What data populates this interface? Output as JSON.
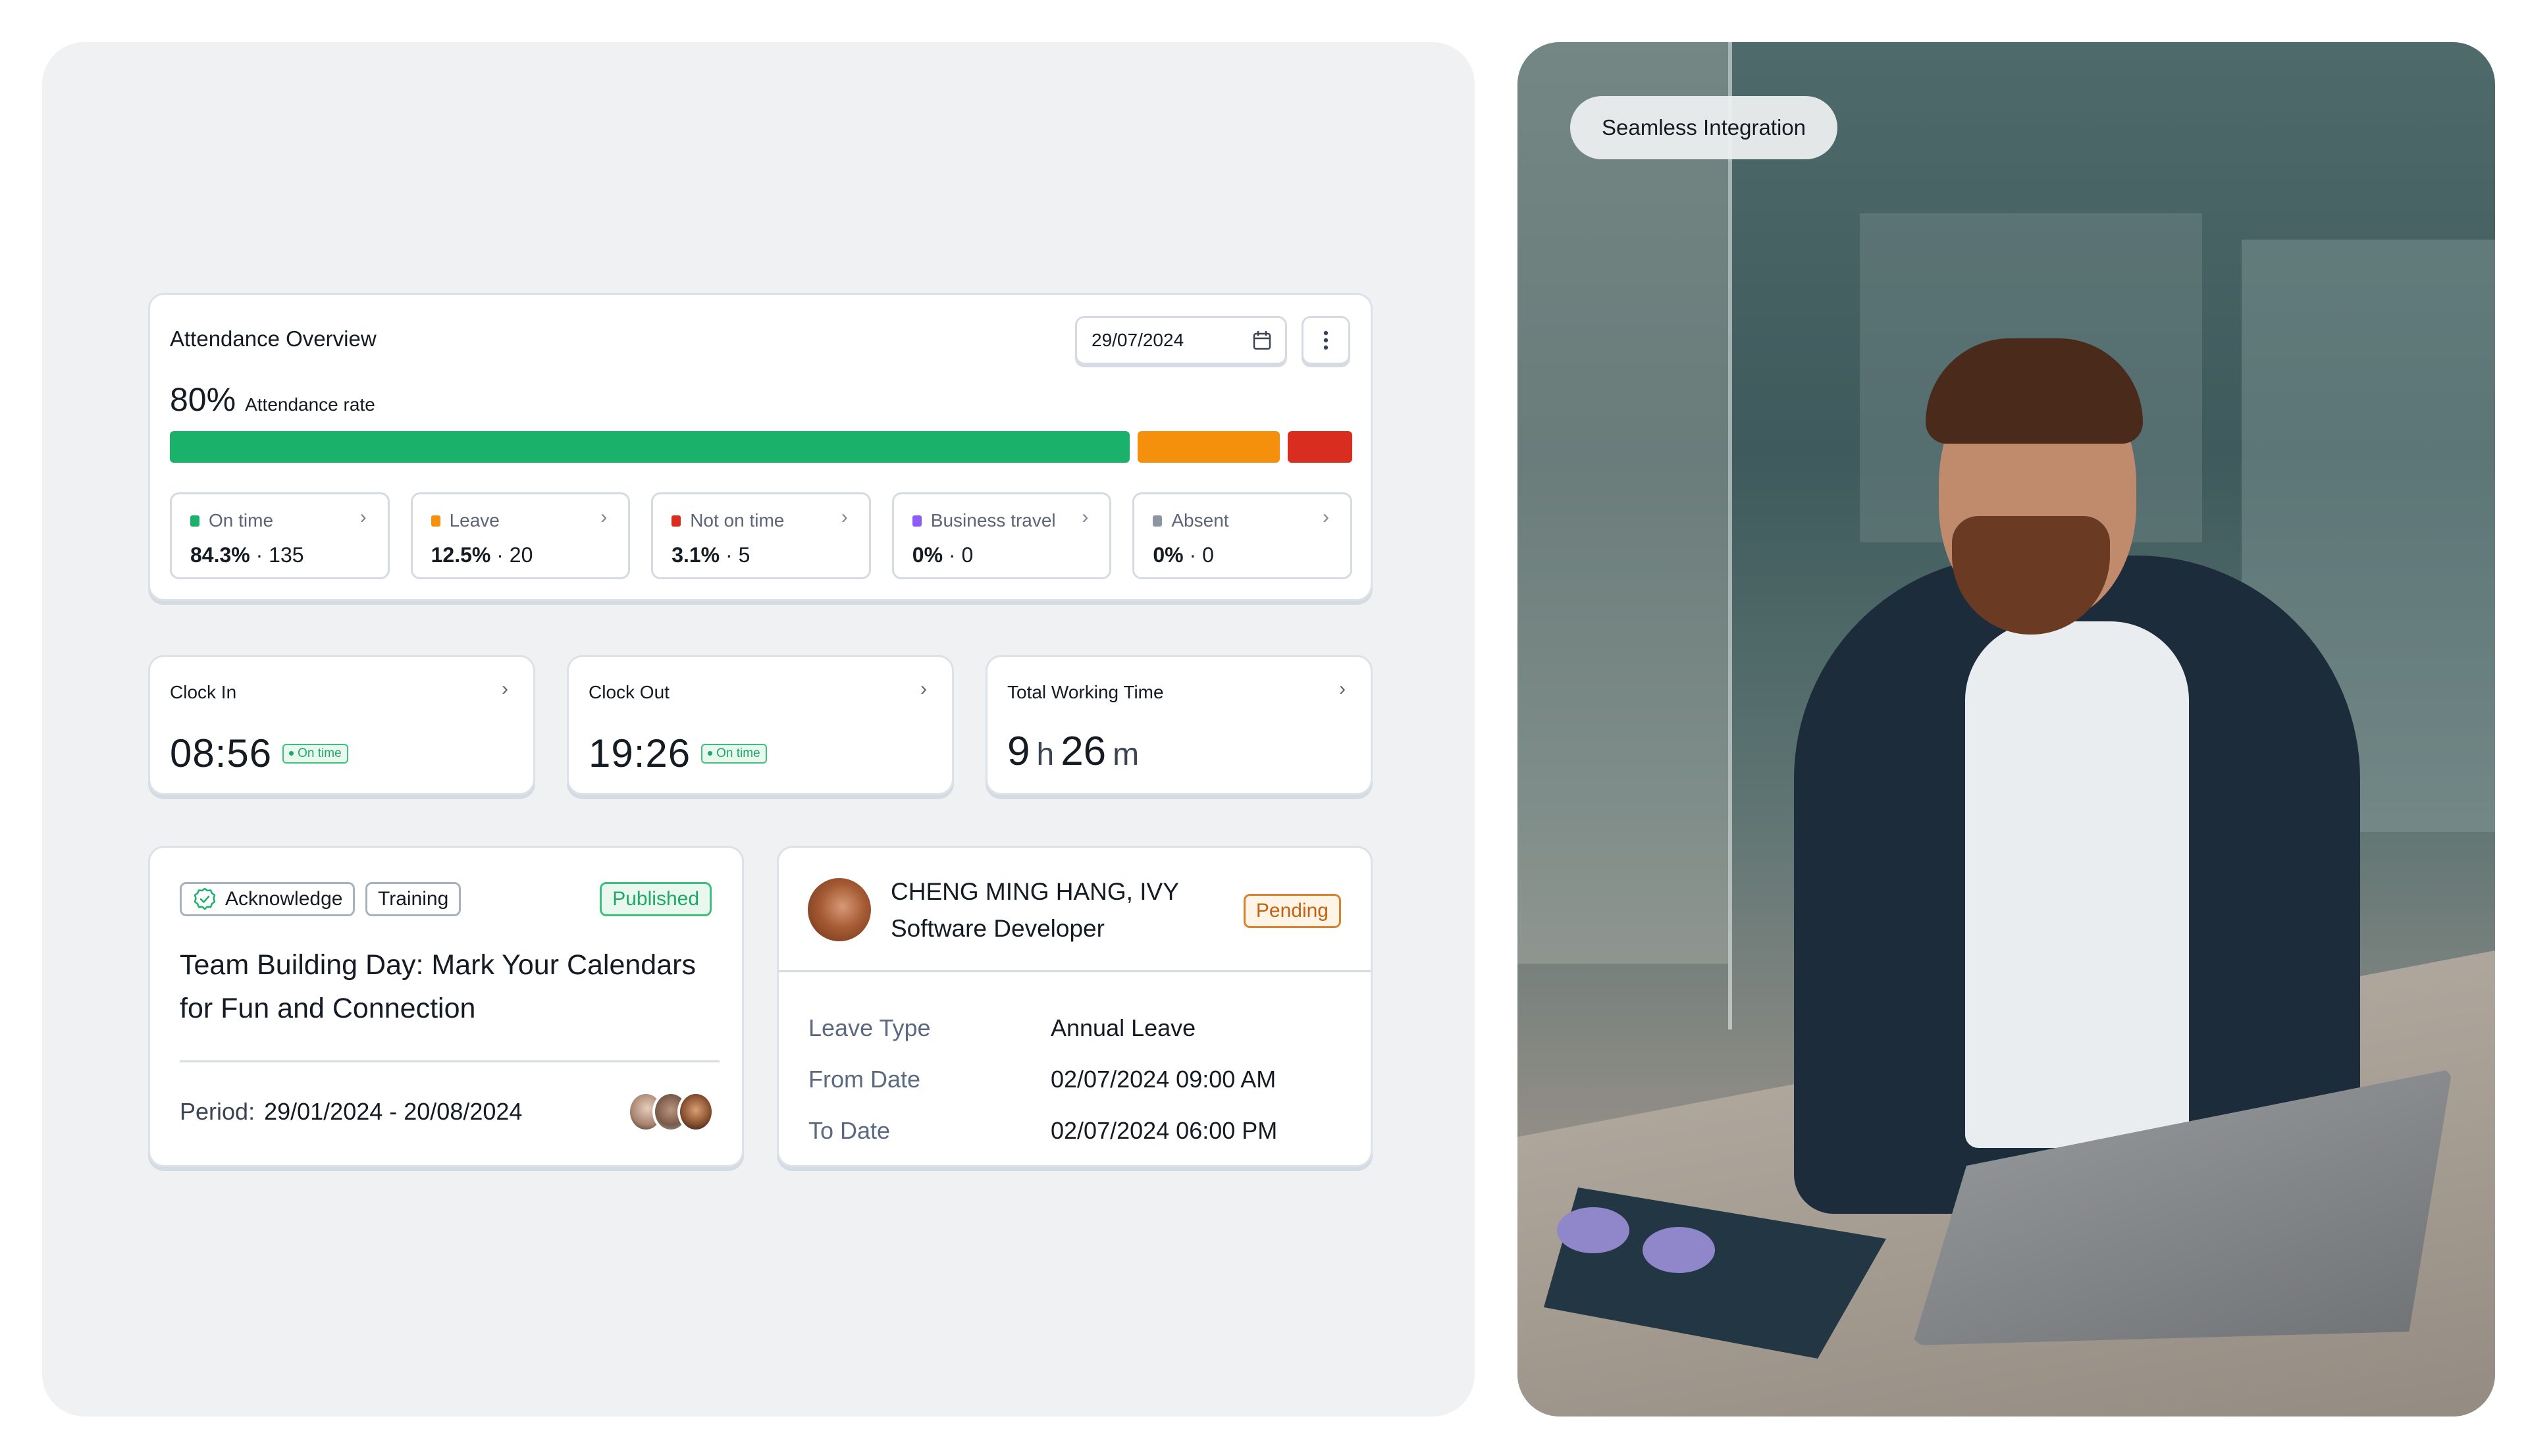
{
  "attendance": {
    "title": "Attendance Overview",
    "date": "29/07/2024",
    "date_icon": "calendar-icon",
    "more_icon": "more-vertical-icon",
    "rate_value": "80%",
    "rate_label": "Attendance rate",
    "distribution": [
      {
        "name": "On time",
        "percent": 84.3,
        "color": "#1ab26b"
      },
      {
        "name": "Leave",
        "percent": 12.5,
        "color": "#f5900c"
      },
      {
        "name": "Not on time",
        "percent": 3.1,
        "color": "#d92d20"
      }
    ],
    "stats": [
      {
        "label": "On time",
        "percent": "84.3%",
        "count": "135",
        "color": "#1ab26b"
      },
      {
        "label": "Leave",
        "percent": "12.5%",
        "count": "20",
        "color": "#f5900c"
      },
      {
        "label": "Not on time",
        "percent": "3.1%",
        "count": "5",
        "color": "#d92d20"
      },
      {
        "label": "Business travel",
        "percent": "0%",
        "count": "0",
        "color": "#8b5cf6"
      },
      {
        "label": "Absent",
        "percent": "0%",
        "count": "0",
        "color": "#8e95a2"
      }
    ],
    "separator": "·",
    "chevron": "›"
  },
  "clock_in": {
    "title": "Clock In",
    "time": "08:56",
    "status": "On time"
  },
  "clock_out": {
    "title": "Clock Out",
    "time": "19:26",
    "status": "On time"
  },
  "total_working_time": {
    "title": "Total Working Time",
    "hours": "9",
    "hours_unit": "h",
    "minutes": "26",
    "minutes_unit": "m"
  },
  "announcement": {
    "tags": [
      "Acknowledge",
      "Training"
    ],
    "status": "Published",
    "title": "Team Building Day: Mark Your Calendars for Fun and Connection",
    "period_label": "Period:",
    "period_value": "29/01/2024 - 20/08/2024",
    "participants_count": 3
  },
  "leave_request": {
    "name": "CHENG MING HANG, IVY",
    "role": "Software Developer",
    "status": "Pending",
    "rows": [
      {
        "label": "Leave Type",
        "value": "Annual Leave"
      },
      {
        "label": "From Date",
        "value": "02/07/2024 09:00 AM"
      },
      {
        "label": "To Date",
        "value": "02/07/2024 06:00 PM"
      }
    ]
  },
  "hero": {
    "pill_label": "Seamless Integration"
  },
  "colors": {
    "success": "#1ab26b",
    "warning": "#f5900c",
    "danger": "#d92d20",
    "purple": "#8b5cf6",
    "muted": "#8e95a2",
    "panel_bg": "#eff1f3"
  }
}
